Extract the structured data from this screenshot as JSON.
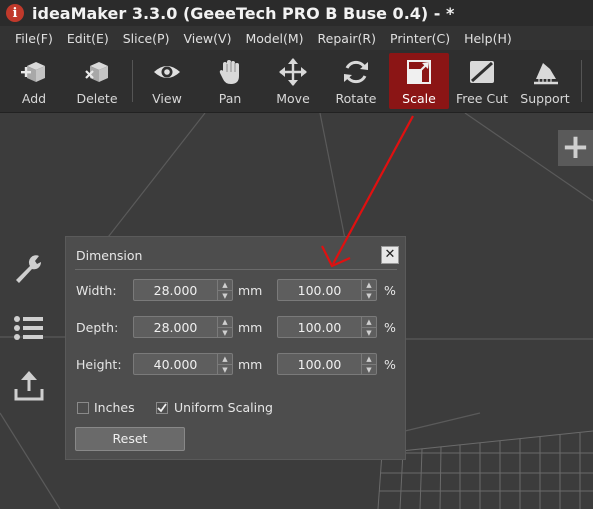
{
  "window": {
    "title": "ideaMaker 3.3.0 (GeeeTech PRO B Buse 0.4) - *",
    "logo_letter": "i"
  },
  "menu": [
    {
      "label": "File(F)"
    },
    {
      "label": "Edit(E)"
    },
    {
      "label": "Slice(P)"
    },
    {
      "label": "View(V)"
    },
    {
      "label": "Model(M)"
    },
    {
      "label": "Repair(R)"
    },
    {
      "label": "Printer(C)"
    },
    {
      "label": "Help(H)"
    }
  ],
  "toolbar": {
    "add": "Add",
    "delete": "Delete",
    "view": "View",
    "pan": "Pan",
    "move": "Move",
    "rotate": "Rotate",
    "scale": "Scale",
    "free_cut": "Free Cut",
    "support": "Support",
    "active_tool": "Scale"
  },
  "viewport": {
    "plus_label": "+"
  },
  "dimension_panel": {
    "title": "Dimension",
    "close_label": "✕",
    "rows": [
      {
        "label": "Width:",
        "value": "28.000",
        "unit": "mm",
        "percent": "100.00",
        "percent_unit": "%"
      },
      {
        "label": "Depth:",
        "value": "28.000",
        "unit": "mm",
        "percent": "100.00",
        "percent_unit": "%"
      },
      {
        "label": "Height:",
        "value": "40.000",
        "unit": "mm",
        "percent": "100.00",
        "percent_unit": "%"
      }
    ],
    "inches": {
      "label": "Inches",
      "checked": false
    },
    "uniform_scaling": {
      "label": "Uniform Scaling",
      "checked": true
    },
    "reset_label": "Reset"
  },
  "colors": {
    "active_tool_bg": "#8b1515",
    "annotation_arrow": "#e01010"
  }
}
